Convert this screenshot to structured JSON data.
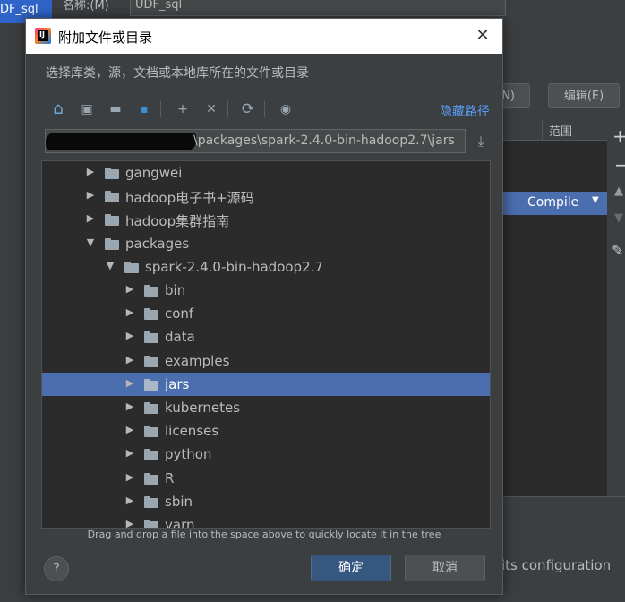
{
  "background": {
    "tab_label": "DF_sql",
    "name_label": "名称:(M)",
    "name_value": "UDF_sql",
    "n_button_label": "N)",
    "edit_button_label": "编辑(E)",
    "table_scope_header": "范围",
    "compile_value": "Compile",
    "config_text": "its configuration"
  },
  "dialog": {
    "title": "附加文件或目录",
    "description": "选择库类，源，文档或本地库所在的文件或目录",
    "hide_path_label": "隐藏路径",
    "path_value": "\\packages\\spark-2.4.0-bin-hadoop2.7\\jars",
    "hint": "Drag and drop a file into the space above to quickly locate it in the tree",
    "ok_label": "确定",
    "cancel_label": "取消",
    "help_label": "?"
  },
  "tree": [
    {
      "label": "gangwei",
      "expanded": false
    },
    {
      "label": "hadoop电子书+源码",
      "expanded": false
    },
    {
      "label": "hadoop集群指南",
      "expanded": false
    },
    {
      "label": "packages",
      "expanded": true
    },
    {
      "label": "spark-2.4.0-bin-hadoop2.7",
      "expanded": true
    },
    {
      "label": "bin",
      "expanded": false
    },
    {
      "label": "conf",
      "expanded": false
    },
    {
      "label": "data",
      "expanded": false
    },
    {
      "label": "examples",
      "expanded": false
    },
    {
      "label": "jars",
      "expanded": false,
      "selected": true
    },
    {
      "label": "kubernetes",
      "expanded": false
    },
    {
      "label": "licenses",
      "expanded": false
    },
    {
      "label": "python",
      "expanded": false
    },
    {
      "label": "R",
      "expanded": false
    },
    {
      "label": "sbin",
      "expanded": false
    },
    {
      "label": "yarn",
      "expanded": false
    }
  ],
  "icons": {
    "home": "⌂",
    "desktop": "▣",
    "new_folder": "▬",
    "module": "▪",
    "new_dir": "+",
    "delete": "✕",
    "refresh": "⟳",
    "show_hidden": "◉",
    "download": "⤓",
    "close": "✕"
  },
  "colors": {
    "accent": "#4b6eaf",
    "link": "#589df6",
    "primary_button": "#365880"
  }
}
